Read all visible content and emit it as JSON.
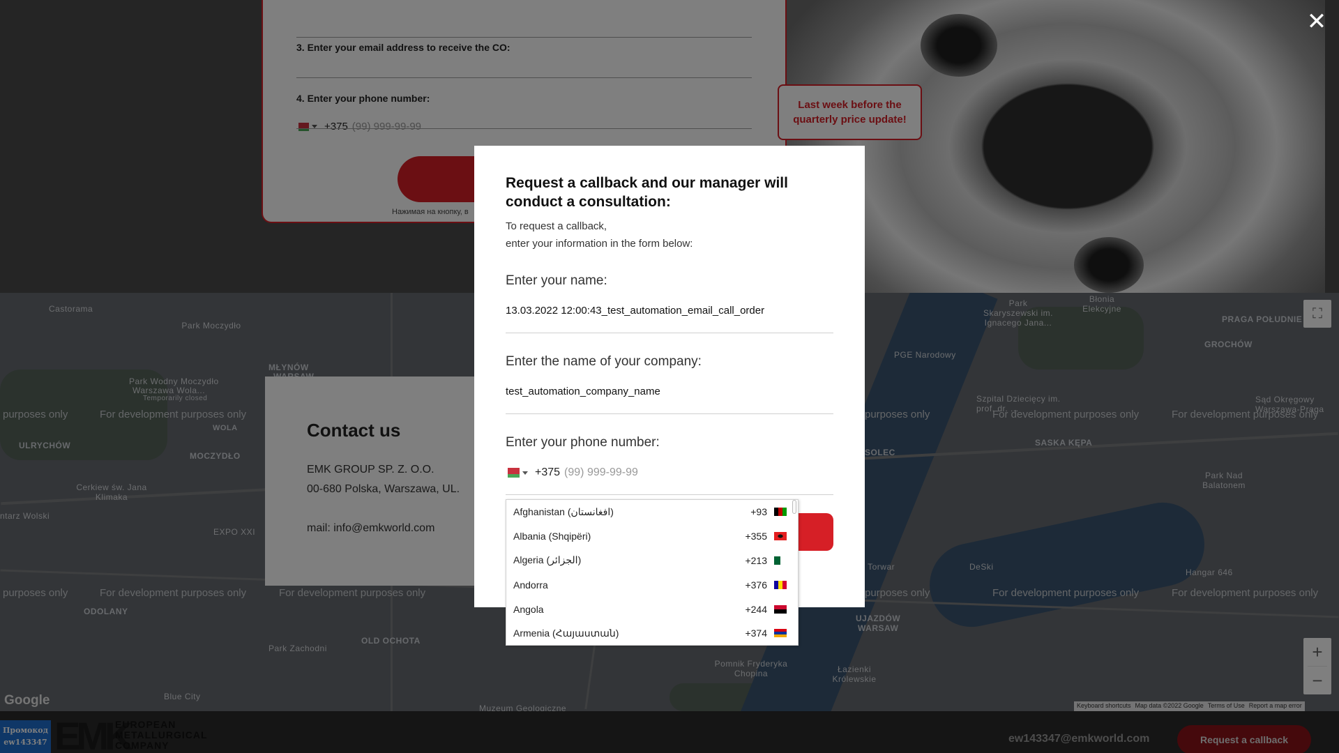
{
  "background_form": {
    "email_label": "3. Enter your email address to receive the CO:",
    "phone_label": "4. Enter your phone number:",
    "phone_prefix": "+375",
    "phone_placeholder": "(99) 999-99-99",
    "consent_note": "Нажимая на кнопку, в"
  },
  "promo_banner": {
    "text": "Last week before the quarterly price update!"
  },
  "contact": {
    "title": "Contact us",
    "company": "EMK GROUP SP. Z. O.O.",
    "address": "00-680 Polska, Warszawa, UL.",
    "mail": "mail: info@emkworld.com"
  },
  "map": {
    "watermark": "For development purposes only",
    "watermark_partial": "purposes only",
    "labels": {
      "castorama": "Castorama",
      "park_moczydlo": "Park Moczydło",
      "mlynow": "MŁYNÓW",
      "warsaw1": "WARSAW",
      "park_wodny": "Park Wodny Moczydło",
      "warszawa_wola": "Warszawa Wola...",
      "temp_closed": "Temporarily closed",
      "wola": "WOLA",
      "ulrychow": "ULRYCHÓW",
      "moczydlo": "MOCZYDŁO",
      "cerkiew": "Cerkiew św. Jana Klimaka",
      "ntarz": "ntarz Wolski",
      "expo": "EXPO XXI",
      "odolany": "ODOLANY",
      "old_ochota": "OLD OCHOTA",
      "park_zachodni": "Park Zachodni",
      "blue_city": "Blue City",
      "muzeum": "Muzeum Geologiczne",
      "pomnik": "Pomnik Fryderyka Chopina",
      "lazienki": "Łazienki Królewskie",
      "ujazdow": "UJAZDÓW",
      "warsaw2": "WARSAW",
      "torwar": "S Torwar",
      "deski": "DeSki",
      "hangar": "Hangar 646",
      "park_nad": "Park Nad Balatonem",
      "saska": "SASKA KĘPA",
      "solec": "SOLEC",
      "szpital": "Szpital Dziecięcy im. prof. dr. ...",
      "sad": "Sąd Okręgowy Warszawa-Praga",
      "grochow": "GROCHÓW",
      "praga": "PRAGA POŁUDNIE",
      "pge": "PGE Narodowy",
      "park_skaryszewski": "Park Skaryszewski im. Ignacego Jana...",
      "blonia": "Błonia Elekcyjne"
    },
    "google": "Google",
    "footer": [
      "Keyboard shortcuts",
      "Map data ©2022 Google",
      "Terms of Use",
      "Report a map error"
    ]
  },
  "footer": {
    "promo_label": "Промокод",
    "promo_code": "ew143347",
    "logo_mark": "EMK",
    "logo_line1": "EUROPEAN",
    "logo_line2": "METALLURGICAL",
    "logo_line3": "COMPANY",
    "email": "ew143347@emkworld.com",
    "callback_button": "Request a callback"
  },
  "modal": {
    "title": "Request a callback and our manager will conduct a consultation:",
    "subtitle_line1": "To request a callback,",
    "subtitle_line2": "enter your information in the form below:",
    "name_label": "Enter your name:",
    "name_value": "13.03.2022 12:00:43_test_automation_email_call_order",
    "company_label": "Enter the name of your company:",
    "company_value": "test_automation_company_name",
    "phone_label": "Enter your phone number:",
    "phone_prefix": "+375",
    "phone_placeholder": "(99) 999-99-99"
  },
  "country_dropdown": {
    "items": [
      {
        "name": "Afghanistan (‫افغانستان‬‎)",
        "code": "+93",
        "flag": "flag-af"
      },
      {
        "name": "Albania (Shqipëri)",
        "code": "+355",
        "flag": "flag-al"
      },
      {
        "name": "Algeria (‫الجزائر‬‎)",
        "code": "+213",
        "flag": "flag-dz"
      },
      {
        "name": "Andorra",
        "code": "+376",
        "flag": "flag-ad"
      },
      {
        "name": "Angola",
        "code": "+244",
        "flag": "flag-ao"
      },
      {
        "name": "Armenia (Հայաստան)",
        "code": "+374",
        "flag": "flag-am"
      }
    ]
  },
  "colors": {
    "accent": "#d61f26",
    "promo_blue": "#1e6fcf"
  },
  "icons": {
    "close": "close-icon",
    "fullscreen": "fullscreen-icon",
    "zoom_in": "plus-icon",
    "zoom_out": "minus-icon",
    "dropdown": "chevron-down-icon"
  }
}
